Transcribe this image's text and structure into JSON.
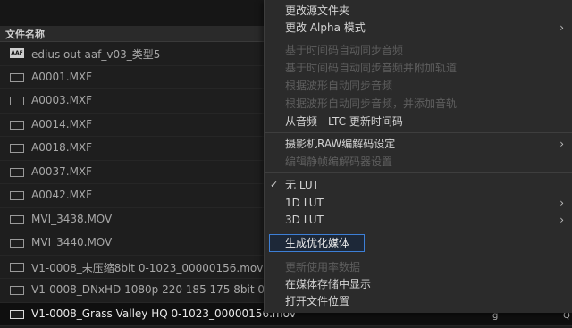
{
  "file_list": {
    "column_header": "文件名称",
    "rows": [
      {
        "name": "edius out aaf_v03_类型5",
        "icon": "aaf-file-icon",
        "badge": "AAF"
      },
      {
        "name": "A0001.MXF",
        "icon": "clip-icon"
      },
      {
        "name": "A0003.MXF",
        "icon": "clip-icon"
      },
      {
        "name": "A0014.MXF",
        "icon": "clip-icon"
      },
      {
        "name": "A0018.MXF",
        "icon": "clip-icon"
      },
      {
        "name": "A0037.MXF",
        "icon": "clip-icon"
      },
      {
        "name": "A0042.MXF",
        "icon": "clip-icon"
      },
      {
        "name": "MVI_3438.MOV",
        "icon": "clip-icon"
      },
      {
        "name": "MVI_3440.MOV",
        "icon": "clip-icon"
      },
      {
        "name": "V1-0008_未压缩8bit 0-1023_00000156.mov",
        "icon": "clip-icon"
      },
      {
        "name": "V1-0008_DNxHD 1080p 220 185 175  8bit 0-1023_00000156.mov",
        "icon": "clip-icon"
      },
      {
        "name": "V1-0008_Grass Valley HQ 0-1023_00000156.mov",
        "icon": "clip-icon",
        "selected": true,
        "trailing": [
          "g",
          "Q"
        ]
      }
    ]
  },
  "context_menu": {
    "items": [
      {
        "label": "更改源文件夹",
        "enabled": true
      },
      {
        "label": "更改 Alpha 模式",
        "enabled": true,
        "submenu": true
      },
      {
        "separator": true
      },
      {
        "label": "基于时间码自动同步音频",
        "enabled": false
      },
      {
        "label": "基于时间码自动同步音频并附加轨道",
        "enabled": false
      },
      {
        "label": "根据波形自动同步音频",
        "enabled": false
      },
      {
        "label": "根据波形自动同步音频，并添加音轨",
        "enabled": false
      },
      {
        "label": "从音频 - LTC 更新时间码",
        "enabled": true
      },
      {
        "separator": true
      },
      {
        "label": "摄影机RAW编解码设定",
        "enabled": true,
        "submenu": true
      },
      {
        "label": "编辑静帧编解码器设置",
        "enabled": false
      },
      {
        "separator": true
      },
      {
        "label": "无 LUT",
        "enabled": true,
        "checked": true
      },
      {
        "label": "1D LUT",
        "enabled": true,
        "submenu": true
      },
      {
        "label": "3D LUT",
        "enabled": true,
        "submenu": true
      },
      {
        "separator": true
      },
      {
        "label": "生成优化媒体",
        "enabled": true,
        "highlighted": true
      },
      {
        "label": "",
        "enabled": false
      },
      {
        "label": "更新使用率数据",
        "enabled": false
      },
      {
        "label": "在媒体存储中显示",
        "enabled": true
      },
      {
        "label": "打开文件位置",
        "enabled": true
      }
    ],
    "check_glyph": "✓",
    "submenu_glyph": "›"
  },
  "colors": {
    "background": "#1e1e1e",
    "menu_background": "#2b2b2b",
    "highlight_border": "#3d7fd6"
  }
}
